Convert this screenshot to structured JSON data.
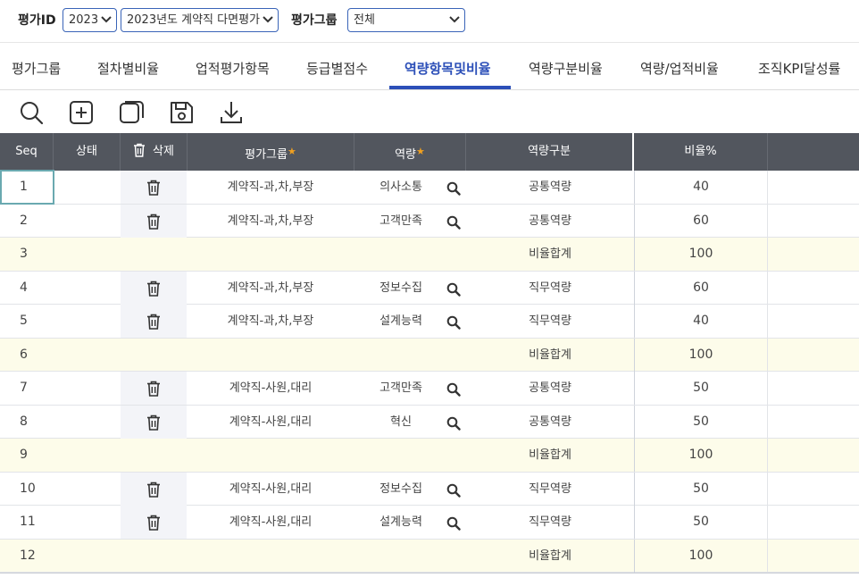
{
  "filters": {
    "eval_id_label": "평가ID",
    "year_value": "2023",
    "eval_name_value": "2023년도 계약직 다면평가",
    "eval_group_label": "평가그룹",
    "eval_group_value": "전체"
  },
  "tabs": [
    {
      "label": "평가그룹"
    },
    {
      "label": "절차별비율"
    },
    {
      "label": "업적평가항목"
    },
    {
      "label": "등급별점수"
    },
    {
      "label": "역량항목및비율",
      "active": true
    },
    {
      "label": "역량구분비율"
    },
    {
      "label": "역량/업적비율"
    },
    {
      "label": "조직KPI달성률"
    }
  ],
  "toolbar": {
    "icons": [
      "search-icon",
      "add-icon",
      "copy-icon",
      "save-icon",
      "download-icon"
    ]
  },
  "grid": {
    "headers": {
      "seq": "Seq",
      "status": "상태",
      "delete": "삭제",
      "group": "평가그룹",
      "competency": "역량",
      "division": "역량구분",
      "ratio": "비율%"
    },
    "rows": [
      {
        "seq": "1",
        "group": "계약직-과,차,부장",
        "competency": "의사소통",
        "division": "공통역량",
        "ratio": "40",
        "subtotal": false
      },
      {
        "seq": "2",
        "group": "계약직-과,차,부장",
        "competency": "고객만족",
        "division": "공통역량",
        "ratio": "60",
        "subtotal": false
      },
      {
        "seq": "3",
        "group": "",
        "competency": "",
        "division": "비율합계",
        "ratio": "100",
        "subtotal": true
      },
      {
        "seq": "4",
        "group": "계약직-과,차,부장",
        "competency": "정보수집",
        "division": "직무역량",
        "ratio": "60",
        "subtotal": false
      },
      {
        "seq": "5",
        "group": "계약직-과,차,부장",
        "competency": "설계능력",
        "division": "직무역량",
        "ratio": "40",
        "subtotal": false
      },
      {
        "seq": "6",
        "group": "",
        "competency": "",
        "division": "비율합계",
        "ratio": "100",
        "subtotal": true
      },
      {
        "seq": "7",
        "group": "계약직-사원,대리",
        "competency": "고객만족",
        "division": "공통역량",
        "ratio": "50",
        "subtotal": false
      },
      {
        "seq": "8",
        "group": "계약직-사원,대리",
        "competency": "혁신",
        "division": "공통역량",
        "ratio": "50",
        "subtotal": false
      },
      {
        "seq": "9",
        "group": "",
        "competency": "",
        "division": "비율합계",
        "ratio": "100",
        "subtotal": true
      },
      {
        "seq": "10",
        "group": "계약직-사원,대리",
        "competency": "정보수집",
        "division": "직무역량",
        "ratio": "50",
        "subtotal": false
      },
      {
        "seq": "11",
        "group": "계약직-사원,대리",
        "competency": "설계능력",
        "division": "직무역량",
        "ratio": "50",
        "subtotal": false
      },
      {
        "seq": "12",
        "group": "",
        "competency": "",
        "division": "비율합계",
        "ratio": "100",
        "subtotal": true
      }
    ]
  },
  "colors": {
    "accent": "#2c4fb8",
    "header_bg": "#52565e",
    "subtotal_bg": "#fdfcea",
    "required_star": "#f0a020"
  }
}
